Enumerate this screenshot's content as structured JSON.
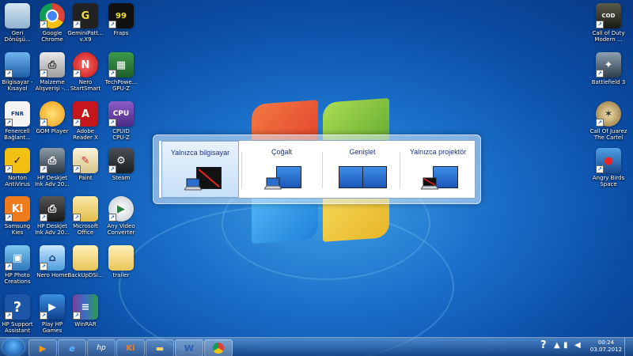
{
  "desktop_icons": {
    "recycle_bin": "Geri\nDönüşü...",
    "google_chrome": "Google\nChrome",
    "gemini_pattern": "GeminiPatt...\nv.X9",
    "fraps": "Fraps",
    "fraps_badge": "99",
    "computer": "Bilgisayar -\nKısayol",
    "malzeme": "Malzeme\nAlışverişi -...",
    "nero_smartstart": "Nero\nStartSmart",
    "techpowerup": "TechPowe...\nGPU-Z",
    "fenercell": "Fenercell\nBağlant...",
    "gom_player": "GOM Player",
    "adobe_reader": "Adobe\nReader X",
    "cpuid": "CPUID\nCPU-Z",
    "norton": "Norton\nAntiVirus",
    "hp_deskjet_1": "HP Deskjet\nInk Adv 20...",
    "paint": "Paint",
    "steam": "Steam",
    "samsung_kies": "Samsung\nKies",
    "hp_deskjet_2": "HP Deskjet\nInk Adv 20...",
    "microsoft_office": "Microsoft\nOffice",
    "any_video_converter": "Any Video\nConverter",
    "hp_photo": "HP Photo\nCreations",
    "nero_home": "Nero Home",
    "backup": "BackUpDSi...",
    "trailer": "trailer",
    "hp_support": "HP Support\nAssistant",
    "play_hp_games": "Play HP\nGames",
    "winrar": "WinRAR",
    "call_of_duty": "Call of Duty\nModern ...",
    "battlefield": "Battlefield 3",
    "call_of_juarez": "Call Of Juarez\nThe Cartel",
    "angry_birds": "Angry Birds\nSpace"
  },
  "projector_dialog": {
    "options": [
      {
        "label": "Yalnızca bilgisayar",
        "selected": true
      },
      {
        "label": "Çoğalt",
        "selected": false
      },
      {
        "label": "Genişlet",
        "selected": false
      },
      {
        "label": "Yalnızca projektör",
        "selected": false
      }
    ]
  },
  "taskbar": {
    "pinned": [
      "windows-media-player",
      "internet-explorer",
      "hp",
      "samsung-kies",
      "windows-explorer",
      "microsoft-word",
      "google-chrome"
    ],
    "clock_time": "00:24",
    "clock_date": "03.07.2012",
    "tray_help": "?"
  },
  "colors": {
    "accent": "#1b57b8",
    "dialog_text": "#1e3287",
    "selected_bg": "#c6dff8"
  }
}
